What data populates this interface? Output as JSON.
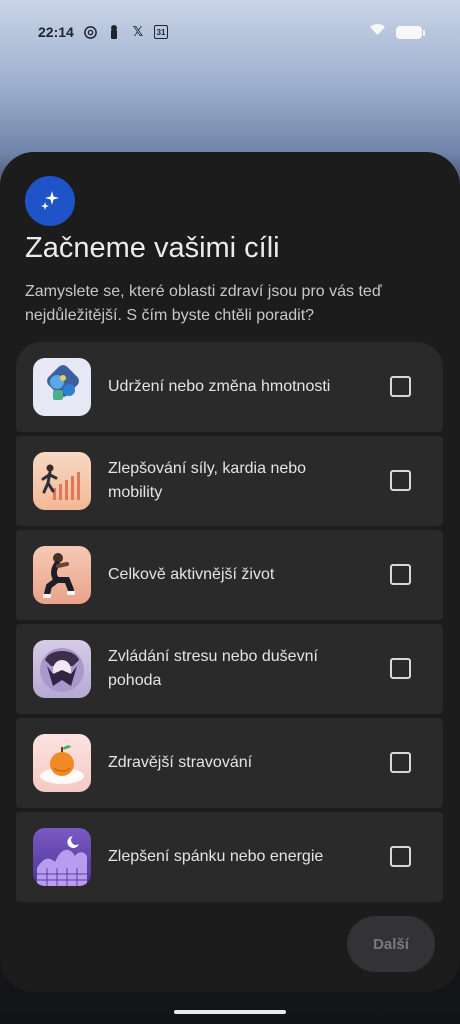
{
  "status_bar": {
    "time": "22:14",
    "left_icons": [
      "openai-icon",
      "lock-key-icon",
      "x-icon",
      "calendar-31-icon"
    ],
    "calendar_text": "31",
    "x_glyph": "𝕏"
  },
  "header": {
    "title": "Začneme vašimi cíli",
    "subtitle": "Zamyslete se, které oblasti zdraví jsou pro vás teď nejdůležitější. S čím byste chtěli poradit?"
  },
  "goals": [
    {
      "label": "Udržení nebo změna hmotnosti",
      "icon": "weight-goal-illustration",
      "checked": false
    },
    {
      "label": "Zlepšování síly, kardia nebo mobility",
      "icon": "runner-illustration",
      "checked": false
    },
    {
      "label": "Celkově aktivnější život",
      "icon": "squat-exercise-illustration",
      "checked": false
    },
    {
      "label": "Zvládání stresu nebo duševní pohoda",
      "icon": "calm-person-illustration",
      "checked": false
    },
    {
      "label": "Zdravější stravování",
      "icon": "orange-fruit-illustration",
      "checked": false
    },
    {
      "label": "Zlepšení spánku nebo energie",
      "icon": "moon-sleep-illustration",
      "checked": false
    }
  ],
  "footer": {
    "next_label": "Další"
  },
  "colors": {
    "accent": "#1f54c9",
    "sheet": "#1c1c1d",
    "row": "#2a2a2b"
  }
}
